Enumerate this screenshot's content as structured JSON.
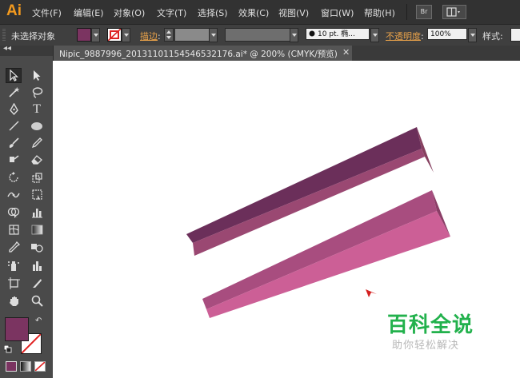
{
  "app": {
    "logo": "Ai"
  },
  "menu": {
    "items": [
      "文件(F)",
      "编辑(E)",
      "对象(O)",
      "文字(T)",
      "选择(S)",
      "效果(C)",
      "视图(V)",
      "窗口(W)",
      "帮助(H)"
    ],
    "bridge_label": "Br"
  },
  "control_bar": {
    "selection_status": "未选择对象",
    "fill_color": "#7b3461",
    "stroke_label": "描边",
    "brush_label": "10 pt. 椭...",
    "opacity_label": "不透明度",
    "opacity_value": "100%",
    "style_label": "样式:"
  },
  "document_tab": {
    "title": "Nipic_9887996_20131101154546532176.ai*  @  200%  (CMYK/预览)",
    "close_icon": "close-icon"
  },
  "tools": {
    "fill_color": "#7b3461",
    "stroke_color": "#ffffff"
  },
  "artwork": {
    "colors": {
      "top_stick_dark": "#6b2f5a",
      "top_stick_mid": "#86405f",
      "top_stick_light": "#9a4872",
      "bottom_stick_dark": "#8a3d66",
      "bottom_stick_mid": "#a84d7f",
      "bottom_stick_light": "#cc5f96"
    }
  },
  "watermark": {
    "main": "百科全说",
    "sub": "助你轻松解决"
  }
}
